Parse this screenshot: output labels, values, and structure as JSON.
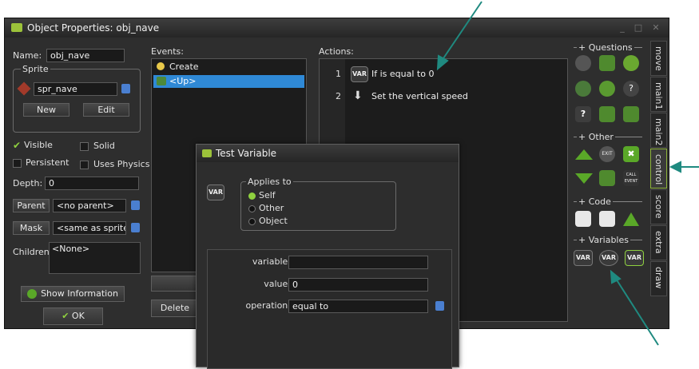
{
  "window": {
    "title": "Object Properties: obj_nave",
    "buttons": [
      "_",
      "□",
      "✕"
    ]
  },
  "props": {
    "name_label": "Name:",
    "name_value": "obj_nave",
    "sprite_label": "Sprite",
    "sprite_value": "spr_nave",
    "new_label": "New",
    "edit_label": "Edit",
    "visible_label": "Visible",
    "solid_label": "Solid",
    "persistent_label": "Persistent",
    "physics_label": "Uses Physics",
    "depth_label": "Depth:",
    "depth_value": "0",
    "parent_label": "Parent",
    "parent_value": "<no parent>",
    "mask_label": "Mask",
    "mask_value": "<same as sprite>",
    "children_label": "Children:",
    "children_value": "<None>",
    "show_info_label": "Show Information",
    "ok_label": "OK"
  },
  "events": {
    "header": "Events:",
    "items": [
      "Create",
      "<Up>"
    ],
    "delete_label": "Delete"
  },
  "actions": {
    "header": "Actions:",
    "items": [
      {
        "num": "1",
        "icon": "VAR",
        "text": "If  is equal to 0"
      },
      {
        "num": "2",
        "icon": "arrow-down",
        "text": "Set the vertical speed"
      }
    ]
  },
  "palette": {
    "questions_label": "Questions",
    "other_label": "Other",
    "code_label": "Code",
    "variables_label": "Variables",
    "exit_label": "EXIT",
    "call_label": "CALL\nEVENT",
    "var_labels": [
      "VAR",
      "VAR",
      "VAR"
    ]
  },
  "tabs": [
    "move",
    "main1",
    "main2",
    "control",
    "score",
    "extra",
    "draw"
  ],
  "dialog": {
    "title": "Test Variable",
    "applies_label": "Applies to",
    "applies_options": [
      "Self",
      "Other",
      "Object"
    ],
    "var_icon": "VAR",
    "variable_label": "variable:",
    "variable_value": "",
    "value_label": "value:",
    "value_value": "0",
    "operation_label": "operation:",
    "operation_value": "equal to"
  },
  "colors": {
    "arrow": "#1f8a80",
    "accent_green": "#8fd13f",
    "selection": "#2f89d6"
  }
}
